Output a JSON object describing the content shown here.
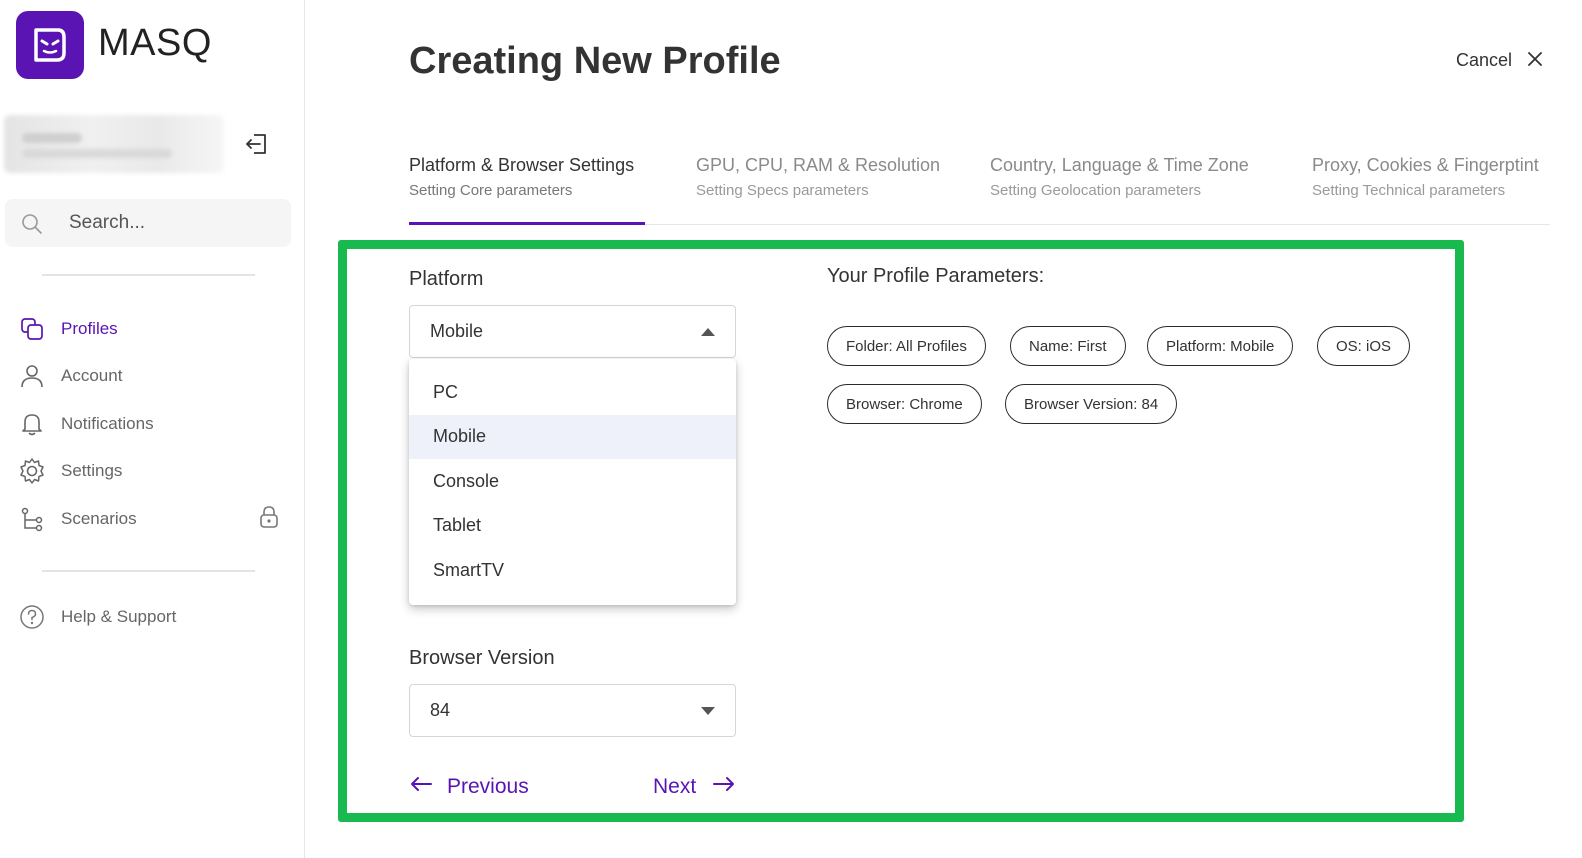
{
  "app": {
    "brand": "MASQ",
    "brand_color": "#5a14b4"
  },
  "sidebar": {
    "search_placeholder": "Search...",
    "items": [
      {
        "label": "Profiles",
        "icon": "profiles-icon",
        "active": true
      },
      {
        "label": "Account",
        "icon": "user-icon"
      },
      {
        "label": "Notifications",
        "icon": "bell-icon"
      },
      {
        "label": "Settings",
        "icon": "gear-icon"
      },
      {
        "label": "Scenarios",
        "icon": "flow-icon",
        "locked": true
      }
    ],
    "help_label": "Help & Support"
  },
  "header": {
    "title": "Creating New Profile",
    "cancel_label": "Cancel"
  },
  "steps": [
    {
      "title": "Platform & Browser Settings",
      "subtitle": "Setting Core parameters",
      "active": true
    },
    {
      "title": "GPU, CPU, RAM & Resolution",
      "subtitle": "Setting Specs parameters"
    },
    {
      "title": "Country, Language & Time Zone",
      "subtitle": "Setting Geolocation parameters"
    },
    {
      "title": "Proxy, Cookies & Fingerptint",
      "subtitle": "Setting Technical parameters"
    }
  ],
  "form": {
    "platform_label": "Platform",
    "platform_value": "Mobile",
    "platform_options": [
      "PC",
      "Mobile",
      "Console",
      "Tablet",
      "SmartTV"
    ],
    "browser_version_label": "Browser Version",
    "browser_version_value": "84",
    "previous_label": "Previous",
    "next_label": "Next"
  },
  "params": {
    "title": "Your Profile Parameters:",
    "chips": [
      "Folder: All Profiles",
      "Name: First",
      "Platform: Mobile",
      "OS: iOS",
      "Browser: Chrome",
      "Browser Version: 84"
    ]
  },
  "colors": {
    "accent": "#5a14b4",
    "highlight": "#18b94e",
    "selected_option_bg": "#eef1fa"
  }
}
